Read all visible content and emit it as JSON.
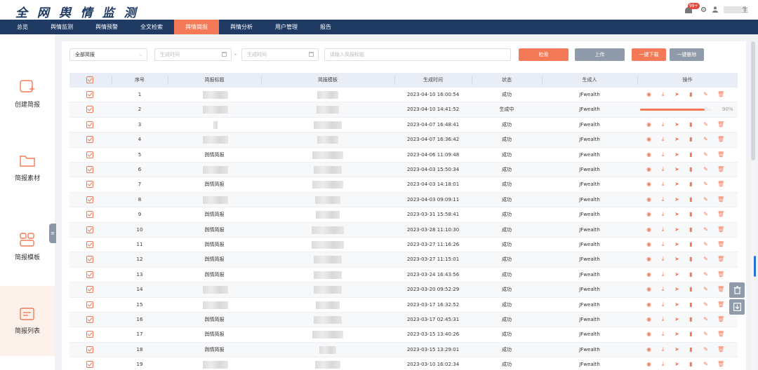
{
  "header": {
    "logo": "全 网 舆 情 监 测",
    "badge": "99+",
    "user_suffix": "生"
  },
  "nav": [
    "总览",
    "舆情监测",
    "舆情预警",
    "全文检索",
    "舆情简报",
    "舆情分析",
    "用户管理",
    "报告"
  ],
  "nav_active": 4,
  "sidebar": [
    {
      "label": "创建简报",
      "icon": "create-report-icon"
    },
    {
      "label": "简报素材",
      "icon": "folder-icon"
    },
    {
      "label": "简报模板",
      "icon": "template-icon"
    },
    {
      "label": "简报列表",
      "icon": "list-icon"
    }
  ],
  "sidebar_active": 3,
  "filters": {
    "type_select": "全部简报",
    "date_start_placeholder": "生成时间",
    "date_end_placeholder": "生成时间",
    "date_sep": "-",
    "search_placeholder": "请输入简报标题",
    "search_btn": "检索",
    "upload_btn": "上传",
    "batch_download_btn": "一键下载",
    "batch_delete_btn": "一键删除"
  },
  "table": {
    "headers": [
      "序号",
      "简报标题",
      "简报模板",
      "生成时间",
      "状态",
      "生成人",
      "操作"
    ],
    "rows": [
      {
        "no": "1",
        "title": "",
        "time": "2023-04-10 16:00:54",
        "status": "成功",
        "creator": "JFwealth"
      },
      {
        "no": "2",
        "title": "",
        "time": "2023-04-10 14:41:52",
        "status": "生成中",
        "creator": "JFwealth",
        "progress": 90,
        "progress_label": "90%"
      },
      {
        "no": "3",
        "title": "",
        "time": "2023-04-07 16:48:41",
        "status": "成功",
        "creator": "JFwealth"
      },
      {
        "no": "4",
        "title": "",
        "time": "2023-04-07 16:36:42",
        "status": "成功",
        "creator": "JFwealth"
      },
      {
        "no": "5",
        "title": "舆情简报",
        "time": "2023-04-06 11:09:48",
        "status": "成功",
        "creator": "JFwealth"
      },
      {
        "no": "6",
        "title": "",
        "time": "2023-04-03 15:50:34",
        "status": "成功",
        "creator": "JFwealth"
      },
      {
        "no": "7",
        "title": "舆情简报",
        "time": "2023-04-03 14:18:01",
        "status": "成功",
        "creator": "JFwealth"
      },
      {
        "no": "8",
        "title": "",
        "time": "2023-04-03 09:09:11",
        "status": "成功",
        "creator": "JFwealth"
      },
      {
        "no": "9",
        "title": "舆情简报",
        "time": "2023-03-31 15:58:41",
        "status": "成功",
        "creator": "JFwealth"
      },
      {
        "no": "10",
        "title": "舆情简报",
        "time": "2023-03-28 11:10:30",
        "status": "成功",
        "creator": "JFwealth"
      },
      {
        "no": "11",
        "title": "舆情简报",
        "time": "2023-03-27 11:16:26",
        "status": "成功",
        "creator": "JFwealth"
      },
      {
        "no": "12",
        "title": "舆情简报",
        "time": "2023-03-27 11:15:01",
        "status": "成功",
        "creator": "JFwealth"
      },
      {
        "no": "13",
        "title": "舆情简报",
        "time": "2023-03-24 16:43:56",
        "status": "成功",
        "creator": "JFwealth"
      },
      {
        "no": "14",
        "title": "",
        "time": "2023-03-20 09:52:29",
        "status": "成功",
        "creator": "JFwealth"
      },
      {
        "no": "15",
        "title": "",
        "time": "2023-03-17 16:32:52",
        "status": "成功",
        "creator": "JFwealth"
      },
      {
        "no": "16",
        "title": "舆情简报",
        "time": "2023-03-17 02:45:31",
        "status": "成功",
        "creator": "JFwealth"
      },
      {
        "no": "17",
        "title": "舆情简报",
        "time": "2023-03-15 13:40:26",
        "status": "成功",
        "creator": "JFwealth"
      },
      {
        "no": "18",
        "title": "舆情简报",
        "time": "2023-03-15 13:29:01",
        "status": "成功",
        "creator": "JFwealth"
      },
      {
        "no": "19",
        "title": "",
        "time": "2023-03-10 16:02:34",
        "status": "成功",
        "creator": "JFwealth"
      }
    ]
  },
  "ops_icons": [
    "view-icon",
    "download-icon",
    "send-icon",
    "export-icon",
    "edit-icon",
    "delete-icon"
  ],
  "colors": {
    "brand": "#f47a57",
    "nav": "#1f3b63",
    "secondary": "#8f9bab"
  }
}
